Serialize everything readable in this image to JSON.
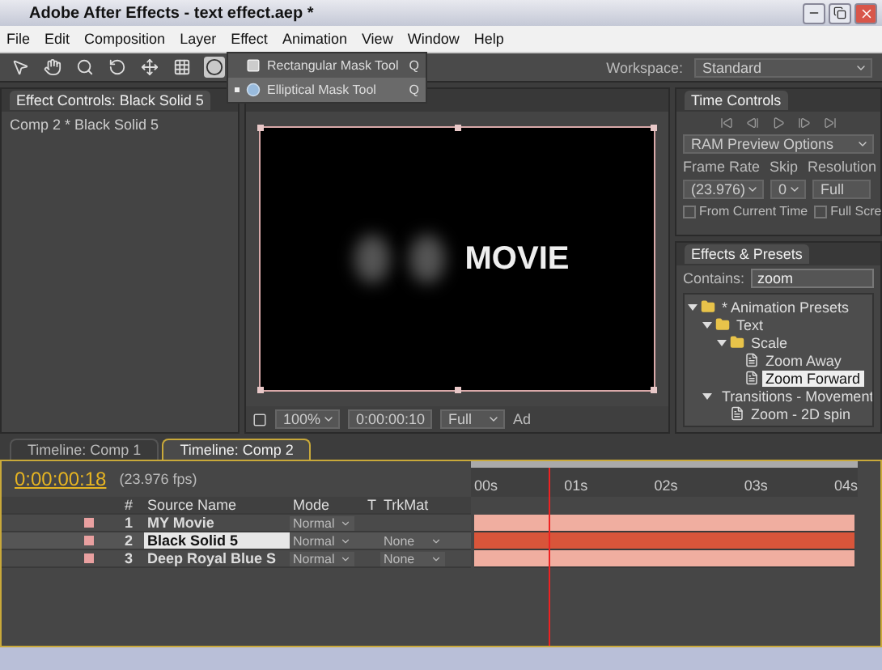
{
  "window": {
    "title": "Adobe After Effects - text effect.aep *"
  },
  "menu": [
    "File",
    "Edit",
    "Composition",
    "Layer",
    "Effect",
    "Animation",
    "View",
    "Window",
    "Help"
  ],
  "toolbar": {
    "workspace_label": "Workspace:",
    "workspace": "Standard"
  },
  "tool_menu": [
    {
      "label": "Rectangular Mask Tool",
      "shortcut": "Q",
      "selected": false
    },
    {
      "label": "Elliptical Mask Tool",
      "shortcut": "Q",
      "selected": true
    }
  ],
  "effect_controls": {
    "tab": "Effect Controls: Black Solid 5",
    "subtitle": "Comp 2 * Black Solid 5"
  },
  "viewer": {
    "comp_text": "MOVIE",
    "zoom": "100%",
    "timecode": "0:00:00:10",
    "resolution": "Full",
    "extra": "Ad"
  },
  "time_controls": {
    "tab": "Time Controls",
    "preview_options": "RAM Preview Options",
    "labels": [
      "Frame Rate",
      "Skip",
      "Resolution"
    ],
    "frame_rate": "(23.976)",
    "skip": "0",
    "resolution": "Full",
    "checkboxes": [
      {
        "label": "From Current Time",
        "checked": false
      },
      {
        "label": "Full Scre",
        "checked": false
      }
    ]
  },
  "effects_presets": {
    "tab": "Effects & Presets",
    "contains_label": "Contains:",
    "search": "zoom",
    "tree": [
      {
        "label": "* Animation Presets",
        "kind": "folder",
        "expanded": true,
        "selected": false,
        "children": [
          {
            "label": "Text",
            "kind": "folder",
            "expanded": true,
            "selected": false,
            "children": [
              {
                "label": "Scale",
                "kind": "folder",
                "expanded": true,
                "selected": false,
                "children": [
                  {
                    "label": "Zoom Away",
                    "kind": "preset",
                    "selected": false
                  },
                  {
                    "label": "Zoom Forward",
                    "kind": "preset",
                    "selected": true
                  }
                ]
              }
            ]
          },
          {
            "label": "Transitions - Movement",
            "kind": "folder",
            "expanded": true,
            "selected": false,
            "children": [
              {
                "label": "Zoom - 2D spin",
                "kind": "preset",
                "selected": false
              }
            ]
          }
        ]
      }
    ]
  },
  "timeline": {
    "tabs": [
      {
        "label": "Timeline: Comp 1",
        "selected": false
      },
      {
        "label": "Timeline: Comp 2",
        "selected": true
      }
    ],
    "timecode": "0:00:00:18",
    "fps": "(23.976 fps)",
    "columns": [
      "#",
      "Source Name",
      "Mode",
      "T",
      "TrkMat"
    ],
    "layers": [
      {
        "number": "1",
        "name": "MY Movie",
        "mode": "Normal",
        "selected": false
      },
      {
        "number": "2",
        "name": "Black Solid 5",
        "mode": "Normal",
        "trkmat": "None",
        "selected": true
      },
      {
        "number": "3",
        "name": "Deep Royal Blue S",
        "mode": "Normal",
        "trkmat": "None",
        "selected": false
      }
    ],
    "ruler": [
      "00s",
      "01s",
      "02s",
      "03s",
      "04s"
    ],
    "playhead": {
      "level": 0.19
    }
  }
}
